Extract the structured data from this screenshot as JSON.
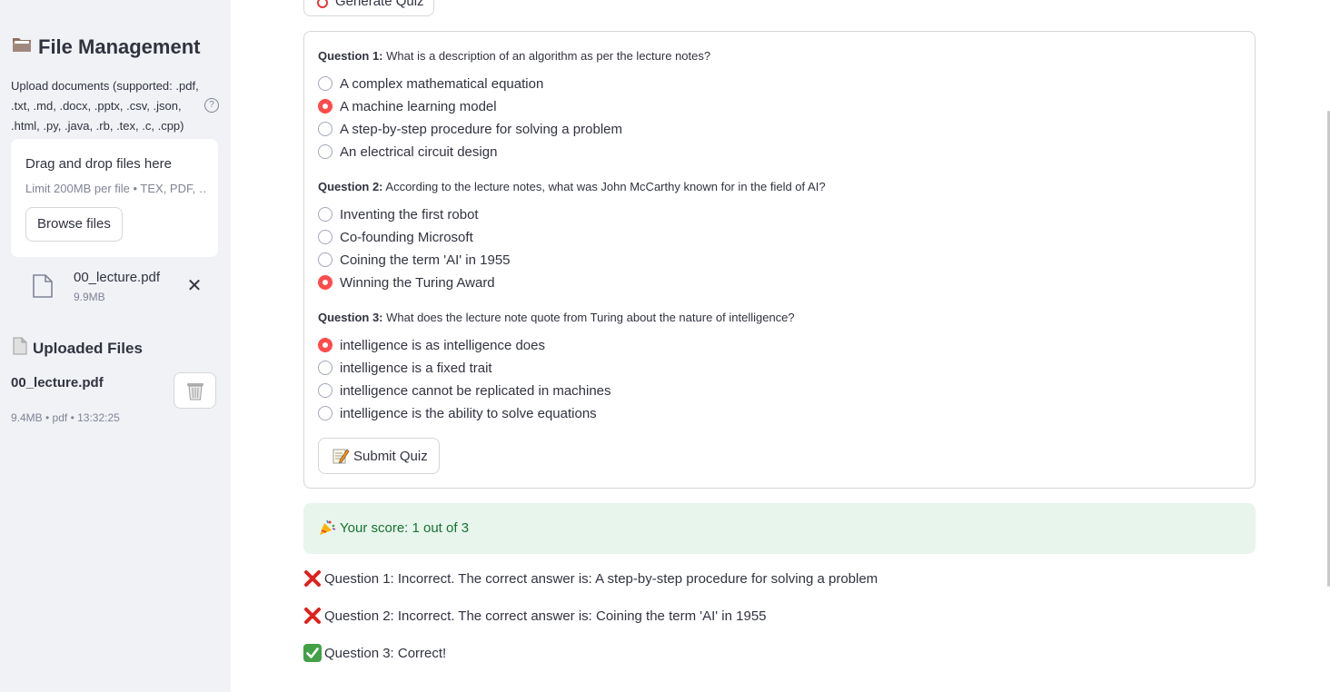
{
  "sidebar": {
    "title": "File Management",
    "upload_help": "Upload documents (supported: .pdf, .txt, .md, .docx, .pptx, .csv, .json, .html, .py, .java, .rb, .tex, .c, .cpp)",
    "help_icon_glyph": "?",
    "dropzone": {
      "title": "Drag and drop files here",
      "limit": "Limit 200MB per file • TEX, PDF, …",
      "browse_label": "Browse files"
    },
    "pending_file": {
      "name": "00_lecture.pdf",
      "size": "9.9MB",
      "close_glyph": "✕"
    },
    "uploaded": {
      "title": "Uploaded Files",
      "file_name": "00_lecture.pdf",
      "file_meta": "9.4MB • pdf • 13:32:25"
    }
  },
  "main": {
    "generate_label": "Generate Quiz",
    "questions": [
      {
        "prefix": "Question 1:",
        "text": " What is a description of an algorithm as per the lecture notes?",
        "options": [
          "A complex mathematical equation",
          "A machine learning model",
          "A step-by-step procedure for solving a problem",
          "An electrical circuit design"
        ],
        "selected": 1
      },
      {
        "prefix": "Question 2:",
        "text": " According to the lecture notes, what was John McCarthy known for in the field of AI?",
        "options": [
          "Inventing the first robot",
          "Co-founding Microsoft",
          "Coining the term 'AI' in 1955",
          "Winning the Turing Award"
        ],
        "selected": 3
      },
      {
        "prefix": "Question 3:",
        "text": " What does the lecture note quote from Turing about the nature of intelligence?",
        "options": [
          "intelligence is as intelligence does",
          "intelligence is a fixed trait",
          "intelligence cannot be replicated in machines",
          "intelligence is the ability to solve equations"
        ],
        "selected": 0
      }
    ],
    "submit_label": "Submit Quiz",
    "score_text": "Your score: 1 out of 3",
    "results": [
      {
        "icon": "x-icon",
        "text": "Question 1: Incorrect. The correct answer is: A step-by-step procedure for solving a problem"
      },
      {
        "icon": "x-icon",
        "text": "Question 2: Incorrect. The correct answer is: Coining the term 'AI' in 1955"
      },
      {
        "icon": "check-icon",
        "text": "Question 3: Correct!"
      }
    ]
  },
  "colors": {
    "accent": "#ff4b4b",
    "success_bg": "#e8f5ec",
    "success_text": "#177233",
    "sidebar_bg": "#f0f2f6"
  }
}
